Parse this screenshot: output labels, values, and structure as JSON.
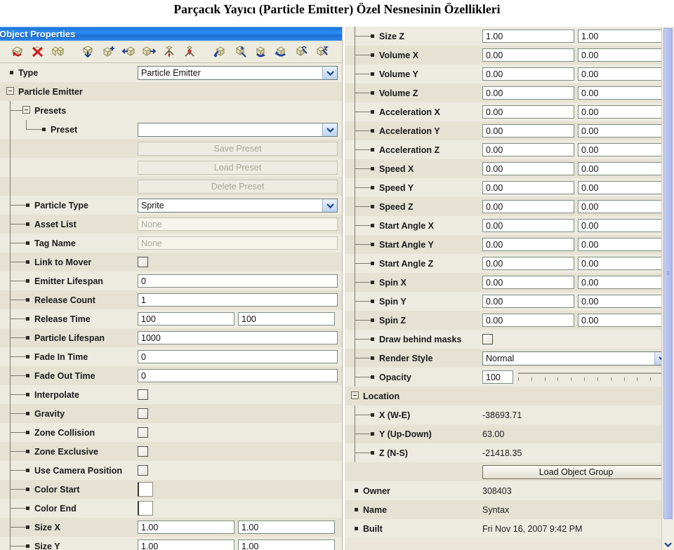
{
  "caption": "Parçacık Yayıcı (Particle Emitter) Özel Nesnesinin Özellikleri",
  "window": {
    "title": "Object Properties",
    "toolbar": {
      "icons": [
        "undo-object-icon",
        "delete-object-icon",
        "duplicate-object-icon",
        "drop-object-icon",
        "add-object-icon",
        "move-object-left-icon",
        "move-object-right-icon",
        "link-object-icon",
        "anchor-object-icon",
        "build-object-icon",
        "build-add-icon",
        "paint-object-icon",
        "recolor-object-icon",
        "tool-object-icon",
        "tool-remove-icon"
      ]
    }
  },
  "left_panel": {
    "type_row": {
      "label": "Type",
      "value": "Particle Emitter"
    },
    "group": "Particle Emitter",
    "presets_group": "Presets",
    "rows": [
      {
        "label": "Preset",
        "kind": "combo",
        "value": ""
      },
      {
        "label": "",
        "kind": "button",
        "value": "Save Preset"
      },
      {
        "label": "",
        "kind": "button",
        "value": "Load Preset"
      },
      {
        "label": "",
        "kind": "button",
        "value": "Delete Preset"
      },
      {
        "label": "Particle Type",
        "kind": "combo",
        "value": "Sprite"
      },
      {
        "label": "Asset List",
        "kind": "text-placeholder",
        "value": "None"
      },
      {
        "label": "Tag Name",
        "kind": "text-placeholder",
        "value": "None"
      },
      {
        "label": "Link to Mover",
        "kind": "checkbox",
        "value": ""
      },
      {
        "label": "Emitter Lifespan",
        "kind": "text",
        "value": "0"
      },
      {
        "label": "Release Count",
        "kind": "text",
        "value": "1"
      },
      {
        "label": "Release Time",
        "kind": "text-pair",
        "value": "100",
        "value2": "100"
      },
      {
        "label": "Particle Lifespan",
        "kind": "text",
        "value": "1000"
      },
      {
        "label": "Fade In Time",
        "kind": "text",
        "value": "0"
      },
      {
        "label": "Fade Out Time",
        "kind": "text",
        "value": "0"
      },
      {
        "label": "Interpolate",
        "kind": "checkbox",
        "value": ""
      },
      {
        "label": "Gravity",
        "kind": "checkbox",
        "value": ""
      },
      {
        "label": "Zone Collision",
        "kind": "checkbox",
        "value": ""
      },
      {
        "label": "Zone Exclusive",
        "kind": "checkbox",
        "value": ""
      },
      {
        "label": "Use Camera Position",
        "kind": "checkbox",
        "value": ""
      },
      {
        "label": "Color Start",
        "kind": "color",
        "value": "#ffffff"
      },
      {
        "label": "Color End",
        "kind": "color",
        "value": "#ffffff"
      },
      {
        "label": "Size X",
        "kind": "text-pair",
        "value": "1.00",
        "value2": "1.00"
      },
      {
        "label": "Size Y",
        "kind": "text-pair",
        "value": "1.00",
        "value2": "1.00"
      }
    ]
  },
  "right_panel": {
    "rows": [
      {
        "label": "Size Z",
        "kind": "text-pair",
        "value": "1.00",
        "value2": "1.00"
      },
      {
        "label": "Volume X",
        "kind": "text-pair",
        "value": "0.00",
        "value2": "0.00"
      },
      {
        "label": "Volume Y",
        "kind": "text-pair",
        "value": "0.00",
        "value2": "0.00"
      },
      {
        "label": "Volume Z",
        "kind": "text-pair",
        "value": "0.00",
        "value2": "0.00"
      },
      {
        "label": "Acceleration X",
        "kind": "text-pair",
        "value": "0.00",
        "value2": "0.00"
      },
      {
        "label": "Acceleration Y",
        "kind": "text-pair",
        "value": "0.00",
        "value2": "0.00"
      },
      {
        "label": "Acceleration Z",
        "kind": "text-pair",
        "value": "0.00",
        "value2": "0.00"
      },
      {
        "label": "Speed X",
        "kind": "text-pair",
        "value": "0.00",
        "value2": "0.00"
      },
      {
        "label": "Speed Y",
        "kind": "text-pair",
        "value": "0.00",
        "value2": "0.00"
      },
      {
        "label": "Speed Z",
        "kind": "text-pair",
        "value": "0.00",
        "value2": "0.00"
      },
      {
        "label": "Start Angle X",
        "kind": "text-pair",
        "value": "0.00",
        "value2": "0.00"
      },
      {
        "label": "Start Angle Y",
        "kind": "text-pair",
        "value": "0.00",
        "value2": "0.00"
      },
      {
        "label": "Start Angle Z",
        "kind": "text-pair",
        "value": "0.00",
        "value2": "0.00"
      },
      {
        "label": "Spin X",
        "kind": "text-pair",
        "value": "0.00",
        "value2": "0.00"
      },
      {
        "label": "Spin Y",
        "kind": "text-pair",
        "value": "0.00",
        "value2": "0.00"
      },
      {
        "label": "Spin Z",
        "kind": "text-pair",
        "value": "0.00",
        "value2": "0.00"
      },
      {
        "label": "Draw behind masks",
        "kind": "checkbox",
        "value": ""
      },
      {
        "label": "Render Style",
        "kind": "combo",
        "value": "Normal"
      },
      {
        "label": "Opacity",
        "kind": "slider",
        "value": "100"
      }
    ],
    "location_group": "Location",
    "location_rows": [
      {
        "label": "X (W-E)",
        "kind": "static",
        "value": "-38693.71"
      },
      {
        "label": "Y (Up-Down)",
        "kind": "static",
        "value": "63.00"
      },
      {
        "label": "Z (N-S)",
        "kind": "static",
        "value": "-21418.35"
      }
    ],
    "load_group_button": "Load Object Group",
    "meta_rows": [
      {
        "label": "Owner",
        "kind": "static",
        "value": "308403"
      },
      {
        "label": "Name",
        "kind": "static",
        "value": "Syntax"
      },
      {
        "label": "Built",
        "kind": "static",
        "value": "Fri Nov 16, 2007 9:42 PM"
      }
    ]
  },
  "colors": {
    "titlebar_blue": "#2d8ef5",
    "row_odd": "#e5e2d4",
    "row_even": "#edebe0",
    "scrollbar_thumb": "#b7c2ee"
  }
}
